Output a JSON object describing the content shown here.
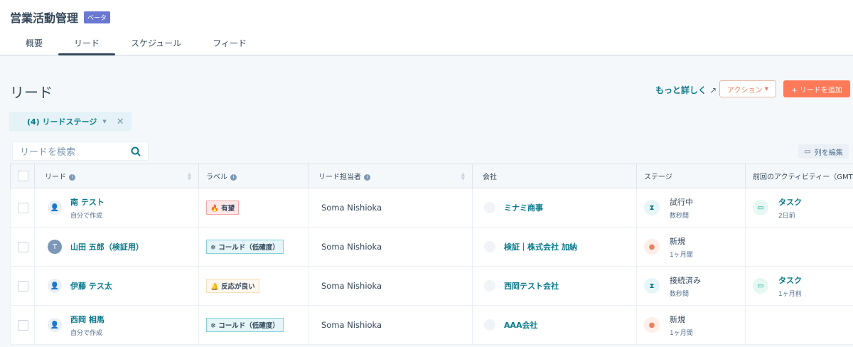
{
  "header": {
    "title": "営業活動管理",
    "beta": "ベータ",
    "tabs": [
      "概要",
      "リード",
      "スケジュール",
      "フィード"
    ],
    "active_tab": 1
  },
  "page": {
    "title": "リード",
    "learn_more": "もっと詳しく",
    "action": "アクション",
    "add_lead": "+ リードを追加"
  },
  "filter": {
    "label": "(4) リードステージ"
  },
  "search": {
    "placeholder": "リードを検索"
  },
  "edit_columns": "列を編集",
  "table": {
    "columns": [
      "リード",
      "ラベル",
      "リード担当者",
      "会社",
      "ステージ",
      "前回のアクティビティー（GMT+"
    ],
    "rows": [
      {
        "name": "南 テスト",
        "sub": "自分で作成",
        "avatar": "",
        "label": "有望",
        "label_type": "hot",
        "label_icon": "🔥",
        "owner": "Soma Nishioka",
        "company": "ミナミ商事",
        "stage": "試行中",
        "stage_time": "数秒間",
        "stage_type": "hour",
        "activity": "タスク",
        "activity_time": "2日前"
      },
      {
        "name": "山田 五郎（検証用）",
        "sub": "",
        "avatar": "T",
        "label": "コールド（低確度）",
        "label_type": "cold",
        "label_icon": "❄",
        "owner": "Soma Nishioka",
        "company": "検証｜株式会社 加納",
        "stage": "新規",
        "stage_time": "1ヶ月間",
        "stage_type": "new",
        "activity": "",
        "activity_time": ""
      },
      {
        "name": "伊藤 テス太",
        "sub": "",
        "avatar": "",
        "label": "反応が良い",
        "label_type": "good",
        "label_icon": "🔔",
        "owner": "Soma Nishioka",
        "company": "西岡テスト会社",
        "stage": "接続済み",
        "stage_time": "数秒間",
        "stage_type": "hour",
        "activity": "タスク",
        "activity_time": "1ヶ月前"
      },
      {
        "name": "西岡 相馬",
        "sub": "自分で作成",
        "avatar": "",
        "label": "コールド（低確度）",
        "label_type": "cold",
        "label_icon": "❄",
        "owner": "Soma Nishioka",
        "company": "AAA会社",
        "stage": "新規",
        "stage_time": "1ヶ月間",
        "stage_type": "new",
        "activity": "",
        "activity_time": ""
      }
    ]
  }
}
